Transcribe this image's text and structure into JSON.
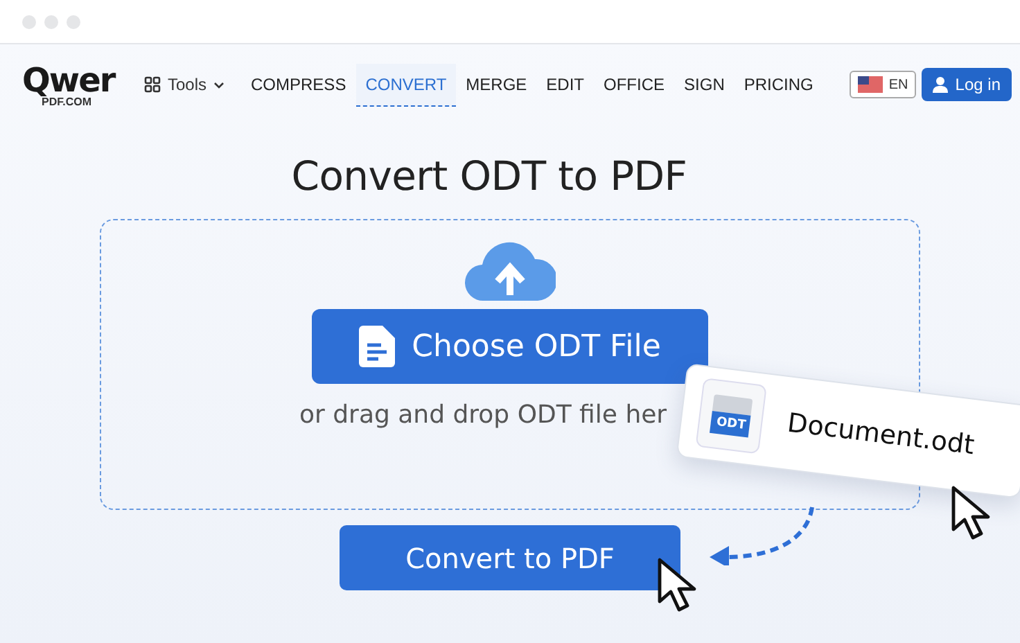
{
  "logo": {
    "wordmark": "Qwer",
    "domain": "PDF.COM"
  },
  "nav": {
    "tools": "Tools",
    "items": [
      {
        "label": "COMPRESS",
        "selected": false
      },
      {
        "label": "CONVERT",
        "selected": true
      },
      {
        "label": "MERGE",
        "selected": false
      },
      {
        "label": "EDIT",
        "selected": false
      },
      {
        "label": "OFFICE",
        "selected": false
      },
      {
        "label": "SIGN",
        "selected": false
      },
      {
        "label": "PRICING",
        "selected": false
      }
    ],
    "language": "EN",
    "login": "Log in"
  },
  "title": "Convert ODT to PDF",
  "upload": {
    "choose_button": "Choose ODT File",
    "hint": "or drag and drop ODT file her"
  },
  "dragged_file": {
    "badge": "ODT",
    "name": "Document.odt"
  },
  "convert_button": "Convert to PDF"
}
